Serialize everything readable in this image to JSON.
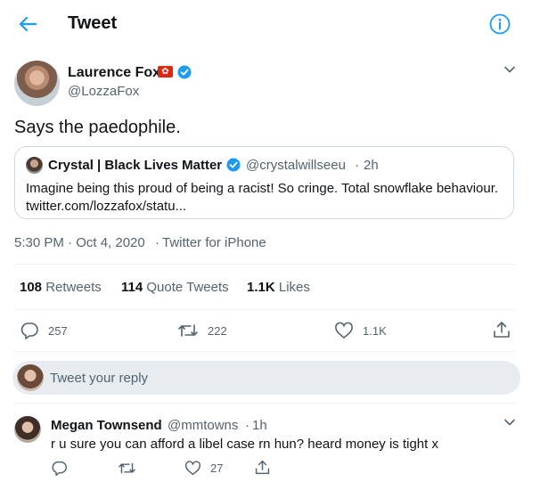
{
  "header": {
    "title": "Tweet"
  },
  "author": {
    "name": "Laurence Fox",
    "handle": "@LozzaFox",
    "flag_icon": "hong-kong-flag-icon",
    "verified_icon": "verified-badge-icon"
  },
  "tweet": {
    "text": "Says the paedophile."
  },
  "quote": {
    "name": "Crystal | Black Lives Matter",
    "handle": "@crystalwillseeu",
    "separator": "·",
    "time": "2h",
    "text": "Imagine being this proud of being a racist! So cringe. Total snowflake behaviour. twitter.com/lozzafox/statu..."
  },
  "meta": {
    "time": "5:30 PM · Oct 4, 2020",
    "separator": "·",
    "source": "Twitter for iPhone"
  },
  "stats": {
    "retweets_count": "108",
    "retweets_label": "Retweets",
    "quotes_count": "114",
    "quotes_label": "Quote Tweets",
    "likes_count": "1.1K",
    "likes_label": "Likes"
  },
  "actions": {
    "reply_count": "257",
    "retweet_count": "222",
    "like_count": "1.1K"
  },
  "reply_box": {
    "placeholder": "Tweet your reply"
  },
  "reply": {
    "name": "Megan Townsend",
    "handle": "@mmtowns",
    "separator": "·",
    "time": "1h",
    "text": "r u sure you can afford a libel case rn hun? heard money is tight x",
    "like_count": "27"
  },
  "colors": {
    "accent": "#1d9bf0",
    "muted": "#536471",
    "flag": "#de2910"
  }
}
